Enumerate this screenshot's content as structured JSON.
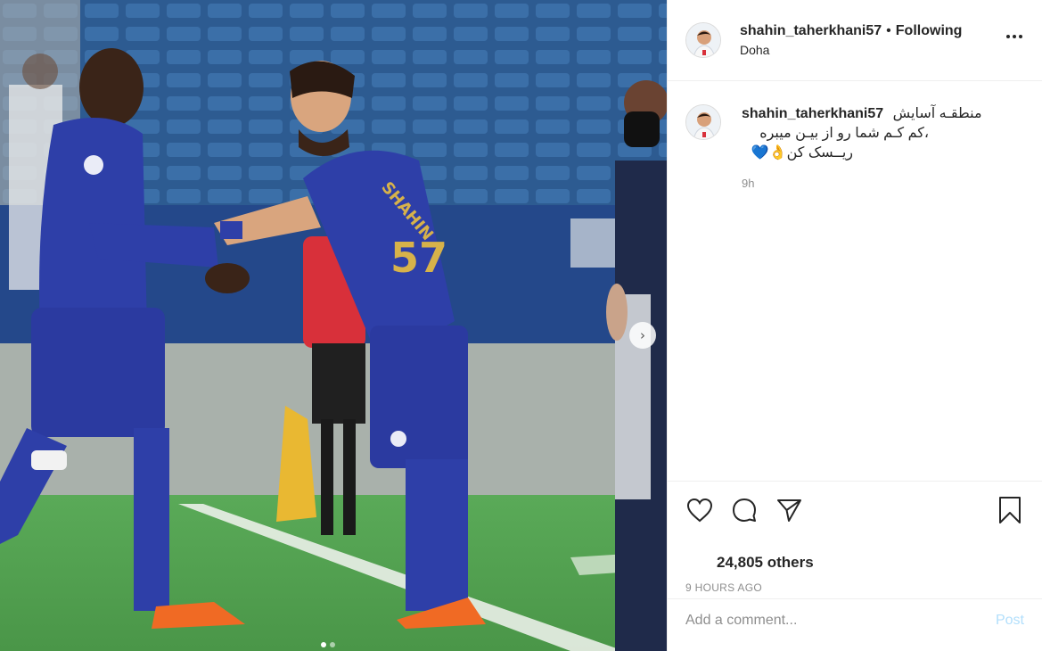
{
  "post": {
    "username": "shahin_taherkhani57",
    "separator": "•",
    "follow_status": "Following",
    "location": "Doha",
    "caption_lines": [
      "منطقـه آسایش",
      "،کم کـم شما رو از بیـن میبره",
      "ریــسک کن👌💙"
    ],
    "caption_time": "9h",
    "likes_text": "24,805 others",
    "time_ago": "9 HOURS AGO"
  },
  "comment_box": {
    "placeholder": "Add a comment...",
    "post_label": "Post"
  },
  "carousel": {
    "next_icon": "›",
    "slide_count": 2,
    "active_slide": 1
  },
  "icons": {
    "like": "heart-icon",
    "comment": "comment-bubble-icon",
    "share": "paper-plane-icon",
    "save": "bookmark-icon",
    "more": "more-dots-icon"
  },
  "colors": {
    "kit_blue": "#2e3fa8",
    "text": "#262626",
    "secondary": "#8e8e8e",
    "post_button_disabled": "#b2dffc"
  }
}
